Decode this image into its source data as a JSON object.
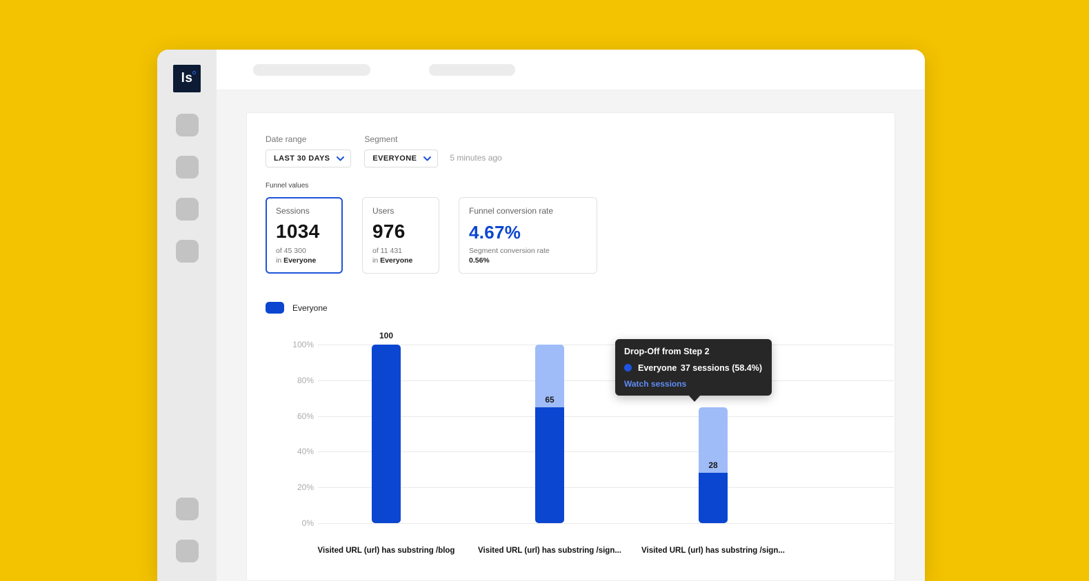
{
  "app": {
    "logo_text": "ls"
  },
  "filters": {
    "date_range_label": "Date range",
    "date_range_value": "LAST 30 DAYS",
    "segment_label": "Segment",
    "segment_value": "EVERYONE",
    "last_updated": "5 minutes ago"
  },
  "funnel_values": {
    "section_label": "Funnel values",
    "cards": [
      {
        "title": "Sessions",
        "value": "1034",
        "subline1": "of 45 300",
        "subline2_prefix": "in ",
        "subline2_bold": "Everyone"
      },
      {
        "title": "Users",
        "value": "976",
        "subline1": "of 11 431",
        "subline2_prefix": "in ",
        "subline2_bold": "Everyone"
      },
      {
        "title": "Funnel conversion rate",
        "value": "4.67%",
        "subline1": "Segment conversion rate",
        "subline2_bold": "0.56%"
      }
    ]
  },
  "legend": {
    "label": "Everyone",
    "color": "#0b46d1"
  },
  "chart_data": {
    "type": "bar",
    "subtype": "funnel",
    "title": "",
    "xlabel": "",
    "ylabel": "",
    "categories": [
      "Visited URL (url) has substring /blog",
      "Visited URL (url) has substring /sign...",
      "Visited URL (url) has substring /sign..."
    ],
    "series": [
      {
        "name": "Everyone",
        "values": [
          100,
          65,
          28
        ]
      }
    ],
    "previous_values": [
      100,
      100,
      65
    ],
    "bar_labels": [
      "100",
      "65",
      "28"
    ],
    "yticks": [
      100,
      80,
      60,
      40,
      20,
      0
    ],
    "ytick_labels": [
      "100%",
      "80%",
      "60%",
      "40%",
      "20%",
      "0%"
    ],
    "ylim": [
      0,
      100
    ],
    "grid": true,
    "legend_position": "top-left",
    "colors": {
      "completed": "#0b46d1",
      "dropoff": "#9fbcf8"
    }
  },
  "tooltip": {
    "title": "Drop-Off from Step 2",
    "series": "Everyone",
    "value": "37 sessions (58.4%)",
    "link": "Watch sessions"
  }
}
